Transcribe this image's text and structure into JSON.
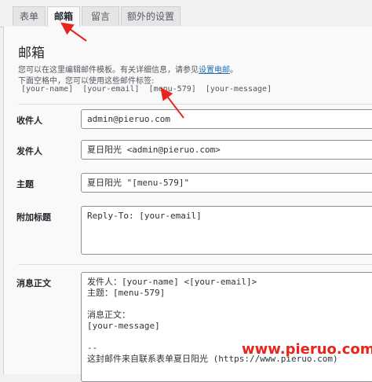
{
  "tabs": [
    {
      "label": "表单",
      "active": false
    },
    {
      "label": "邮箱",
      "active": true
    },
    {
      "label": "留言",
      "active": false
    },
    {
      "label": "额外的设置",
      "active": false
    }
  ],
  "mail": {
    "title": "邮箱",
    "desc_line1_pre": "您可以在这里编辑邮件模板。有关详细信息，请参见",
    "desc_link": "设置电邮",
    "desc_line1_post": "。",
    "desc_line2": "下面空格中，您可以使用这些邮件标签:",
    "tags": "[your-name]  [your-email]  [menu-579]  [your-message]"
  },
  "fields": {
    "recipient_label": "收件人",
    "recipient_value": "admin@pieruo.com",
    "sender_label": "发件人",
    "sender_value": "夏日阳光 <admin@pieruo.com>",
    "subject_label": "主题",
    "subject_value": "夏日阳光 \"[menu-579]\"",
    "headers_label": "附加标题",
    "headers_value": "Reply-To: [your-email]",
    "body_label": "消息正文",
    "body_value": "发件人：[your-name] <[your-email]>\n主题：[menu-579]\n\n消息正文：\n[your-message]\n\n--\n这封邮件来自联系表单夏日阳光 (https://www.pieruo.com)"
  },
  "watermark": "www.pieruo.com",
  "colors": {
    "accent": "#2271b1",
    "annotation": "#e8251b"
  }
}
